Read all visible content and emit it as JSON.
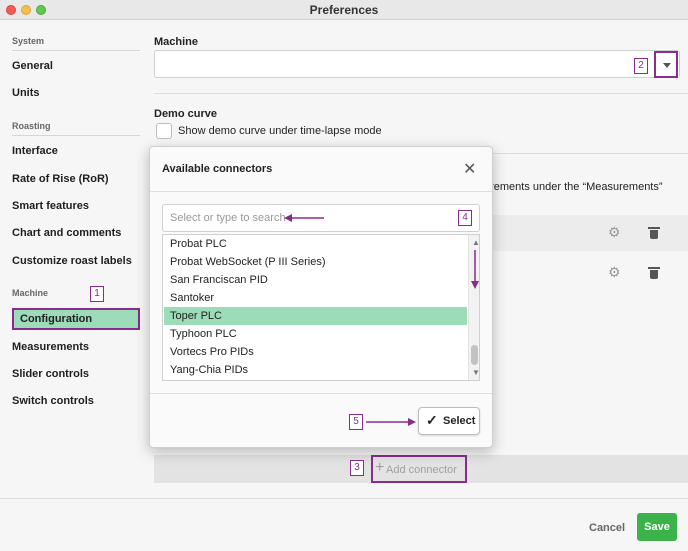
{
  "window": {
    "title": "Preferences"
  },
  "sidebar": {
    "sections": [
      {
        "label": "System",
        "items": [
          "General",
          "Units"
        ]
      },
      {
        "label": "Roasting",
        "items": [
          "Interface",
          "Rate of Rise (RoR)",
          "Smart features",
          "Chart and comments",
          "Customize roast labels"
        ]
      },
      {
        "label": "Machine",
        "items": [
          "Configuration",
          "Measurements",
          "Slider controls",
          "Switch controls"
        ]
      }
    ],
    "active_item": "Configuration"
  },
  "main": {
    "machine_label": "Machine",
    "machine_value": "",
    "demo_curve_label": "Demo curve",
    "demo_curve_checkbox": "Show demo curve under time-lapse mode",
    "truncated_text": "urements under the “Measurements”",
    "add_connector_label": "Add connector"
  },
  "dialog": {
    "title": "Available connectors",
    "search_placeholder": "Select or type to search",
    "items": [
      "Probat PLC",
      "Probat WebSocket (P III Series)",
      "San Franciscan PID",
      "Santoker",
      "Toper PLC",
      "Typhoon PLC",
      "Vortecs Pro PIDs",
      "Yang-Chia PIDs"
    ],
    "selected_item": "Toper PLC",
    "select_button": "Select"
  },
  "footer": {
    "cancel_label": "Cancel",
    "save_label": "Save"
  },
  "annotations": [
    "1",
    "2",
    "3",
    "4",
    "5"
  ],
  "colors": {
    "accent": "#3bb24a",
    "selection": "#9ddcb8",
    "annotation": "#8a2b8e"
  }
}
